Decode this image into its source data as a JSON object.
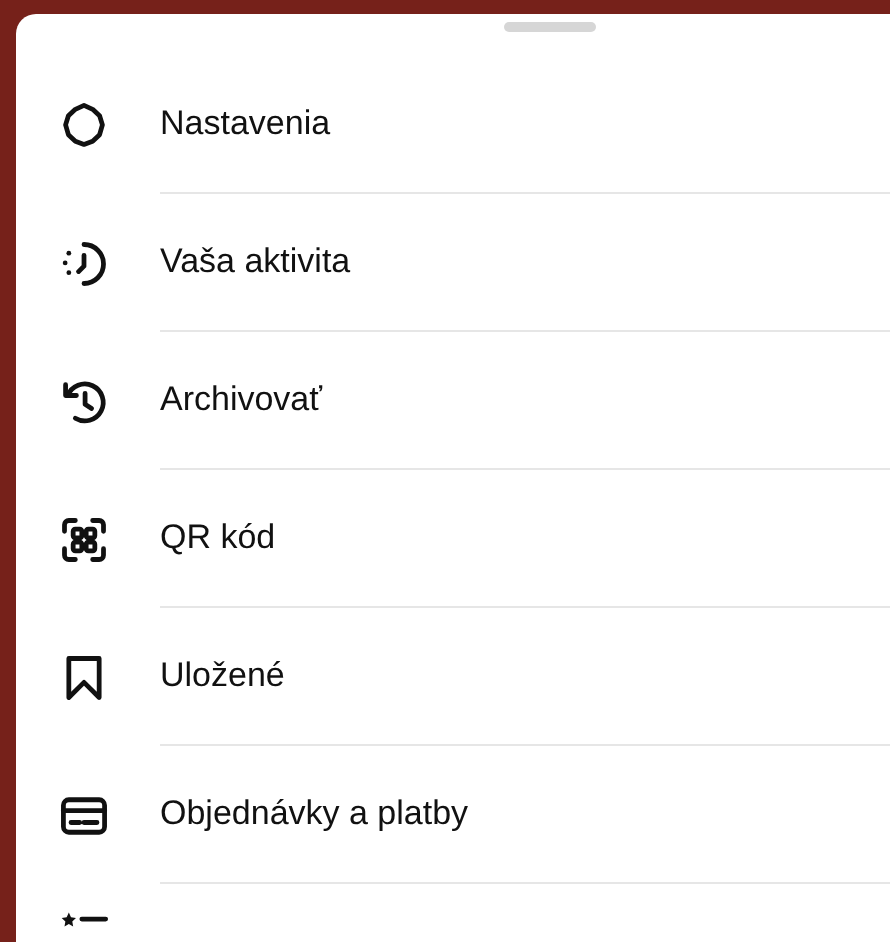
{
  "menu": {
    "items": [
      {
        "label": "Nastavenia"
      },
      {
        "label": "Vaša aktivita"
      },
      {
        "label": "Archivovať"
      },
      {
        "label": "QR kód"
      },
      {
        "label": "Uložené"
      },
      {
        "label": "Objednávky a platby"
      }
    ]
  }
}
